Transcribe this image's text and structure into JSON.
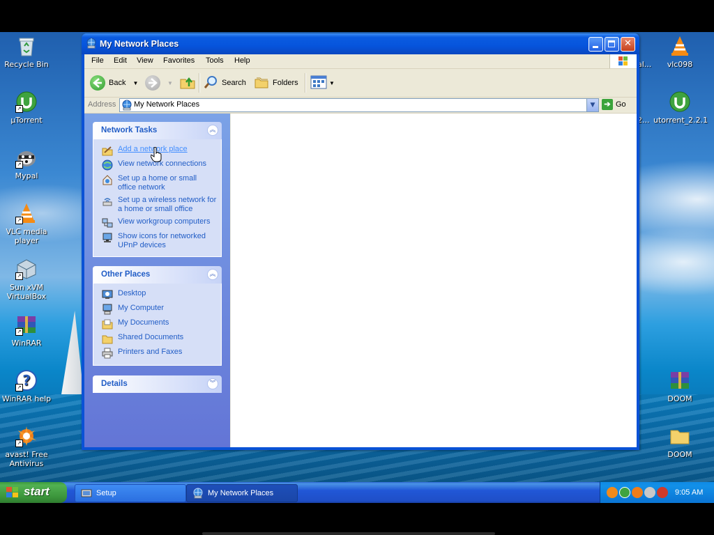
{
  "desktop": {
    "icons_left": [
      {
        "label": "Recycle Bin",
        "icon": "recycle-bin-icon"
      },
      {
        "label": "µTorrent",
        "icon": "utorrent-icon"
      },
      {
        "label": "Mypal",
        "icon": "mypal-icon"
      },
      {
        "label": "VLC media player",
        "icon": "vlc-icon"
      },
      {
        "label": "Sun xVM VirtualBox",
        "icon": "virtualbox-icon"
      },
      {
        "label": "WinRAR",
        "icon": "winrar-icon"
      },
      {
        "label": "WinRAR help",
        "icon": "help-icon"
      },
      {
        "label": "avast! Free Antivirus",
        "icon": "avast-icon"
      }
    ],
    "icons_right": [
      {
        "label": "vlc098",
        "icon": "vlc-icon"
      },
      {
        "label": "utorrent_2.2.1",
        "icon": "utorrent-icon"
      },
      {
        "label": "DOOM",
        "icon": "winrar-icon"
      },
      {
        "label": "DOOM",
        "icon": "folder-icon"
      }
    ],
    "partial_labels": [
      "al...",
      "2..."
    ]
  },
  "window": {
    "title": "My Network Places",
    "menu": [
      "File",
      "Edit",
      "View",
      "Favorites",
      "Tools",
      "Help"
    ],
    "toolbar": {
      "back": "Back",
      "search": "Search",
      "folders": "Folders"
    },
    "address": {
      "label": "Address",
      "value": "My Network Places",
      "go": "Go"
    },
    "network_tasks": {
      "title": "Network Tasks",
      "items": [
        {
          "label": "Add a network place",
          "icon": "add-network-place-icon"
        },
        {
          "label": "View network connections",
          "icon": "network-connections-icon"
        },
        {
          "label": "Set up a home or small office network",
          "icon": "home-network-icon"
        },
        {
          "label": "Set up a wireless network for a home or small office",
          "icon": "wireless-network-icon"
        },
        {
          "label": "View workgroup computers",
          "icon": "workgroup-icon"
        },
        {
          "label": "Show icons for networked UPnP devices",
          "icon": "upnp-icon"
        }
      ]
    },
    "other_places": {
      "title": "Other Places",
      "items": [
        {
          "label": "Desktop",
          "icon": "desktop-icon"
        },
        {
          "label": "My Computer",
          "icon": "my-computer-icon"
        },
        {
          "label": "My Documents",
          "icon": "my-documents-icon"
        },
        {
          "label": "Shared Documents",
          "icon": "shared-documents-icon"
        },
        {
          "label": "Printers and Faxes",
          "icon": "printer-icon"
        }
      ]
    },
    "details": {
      "title": "Details"
    }
  },
  "taskbar": {
    "start": "start",
    "tasks": [
      {
        "label": "Setup"
      },
      {
        "label": "My Network Places"
      }
    ],
    "clock": "9:05 AM"
  }
}
